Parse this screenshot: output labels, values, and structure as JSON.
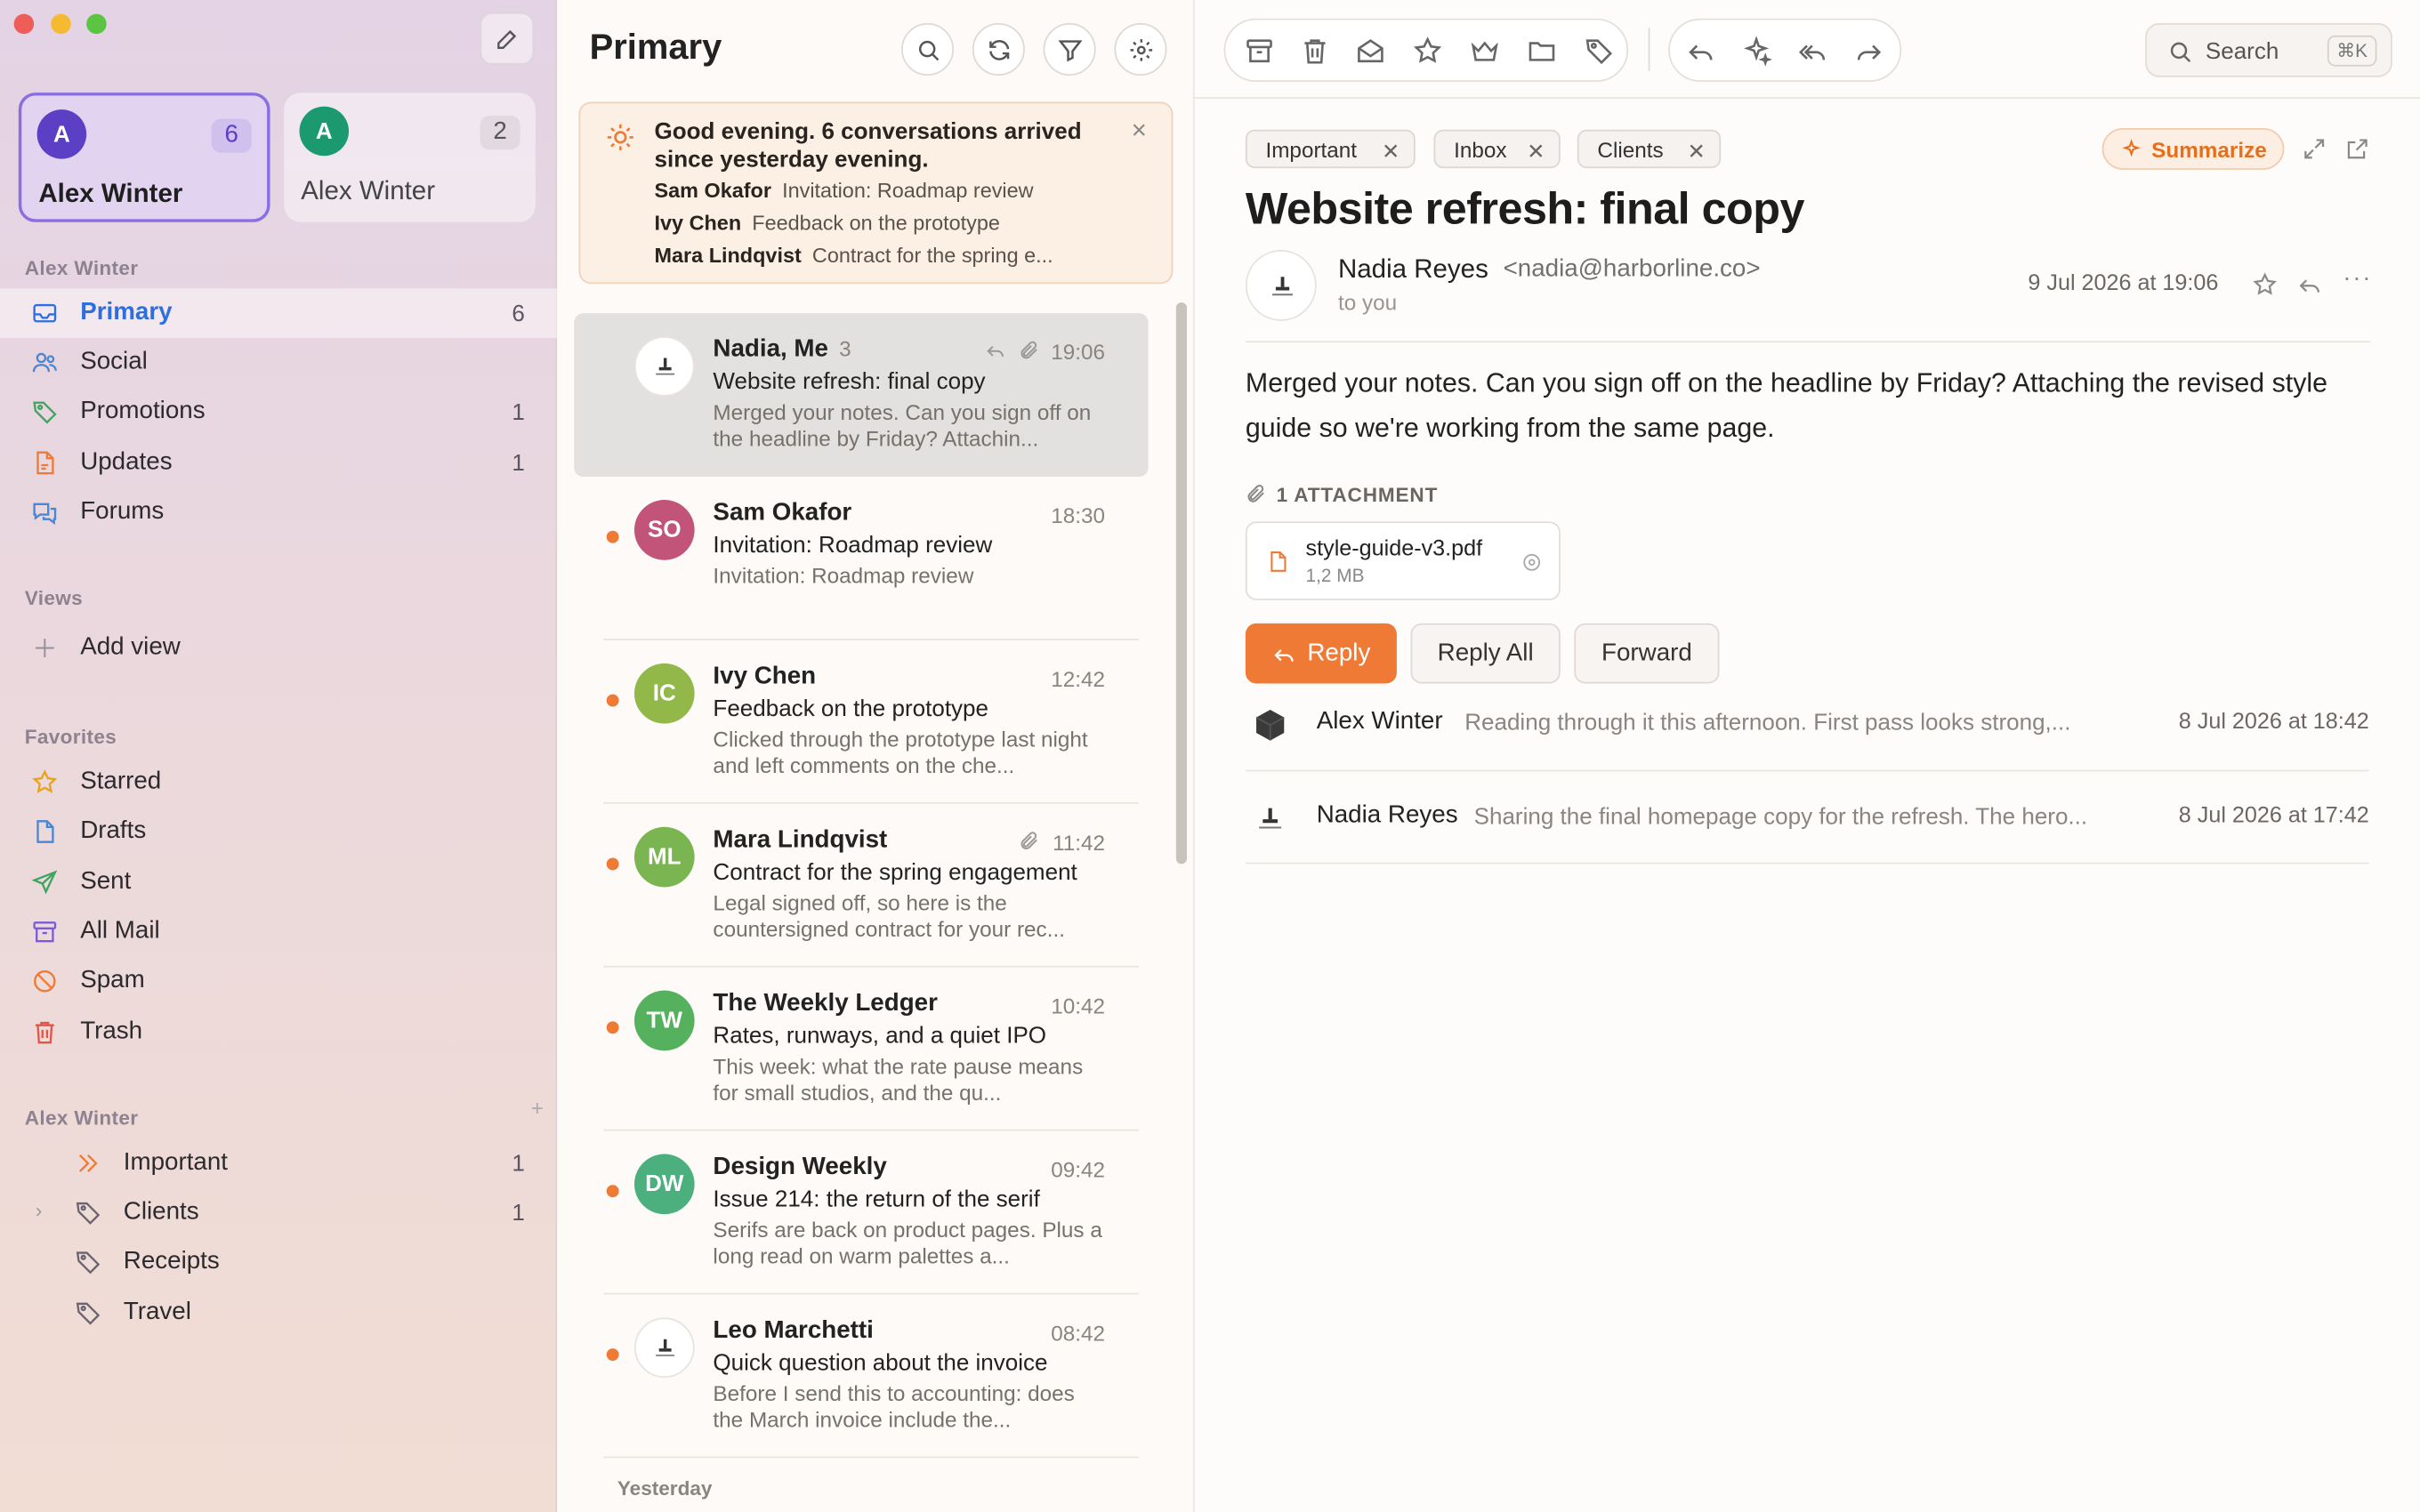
{
  "sidebar": {
    "accounts": [
      {
        "initial": "A",
        "name": "Alex Winter",
        "count": "6",
        "color": "#5b3fc4"
      },
      {
        "initial": "A",
        "name": "Alex Winter",
        "count": "2",
        "color": "#1a9a6e"
      }
    ],
    "account_section": "Alex Winter",
    "mailboxes": [
      {
        "label": "Primary",
        "count": "6",
        "icon": "inbox-icon"
      },
      {
        "label": "Social",
        "count": "",
        "icon": "people-icon"
      },
      {
        "label": "Promotions",
        "count": "1",
        "icon": "tag-icon"
      },
      {
        "label": "Updates",
        "count": "1",
        "icon": "document-icon"
      },
      {
        "label": "Forums",
        "count": "",
        "icon": "chat-bubbles-icon"
      }
    ],
    "views_section": "Views",
    "add_view": "Add view",
    "favorites_section": "Favorites",
    "favorites": [
      {
        "label": "Starred",
        "icon": "star-icon"
      },
      {
        "label": "Drafts",
        "icon": "draft-icon"
      },
      {
        "label": "Sent",
        "icon": "send-icon"
      },
      {
        "label": "All Mail",
        "icon": "archive-icon"
      },
      {
        "label": "Spam",
        "icon": "spam-icon"
      },
      {
        "label": "Trash",
        "icon": "trash-icon"
      }
    ],
    "labels_section": "Alex Winter",
    "labels": [
      {
        "label": "Important",
        "count": "1",
        "icon": "chevrons-right-icon"
      },
      {
        "label": "Clients",
        "count": "1",
        "icon": "tag-icon"
      },
      {
        "label": "Receipts",
        "count": "",
        "icon": "tag-icon"
      },
      {
        "label": "Travel",
        "count": "",
        "icon": "tag-icon"
      }
    ]
  },
  "list": {
    "title": "Primary",
    "digest": {
      "text": "Good evening. 6 conversations arrived since yesterday evening.",
      "rows": [
        {
          "name": "Sam Okafor",
          "subject": "Invitation: Roadmap review"
        },
        {
          "name": "Ivy Chen",
          "subject": "Feedback on the prototype"
        },
        {
          "name": "Mara Lindqvist",
          "subject": "Contract for the spring e..."
        }
      ]
    },
    "messages": [
      {
        "from": "Nadia, Me",
        "count": "3",
        "time": "19:06",
        "subject": "Website refresh: final copy",
        "preview": "Merged your notes. Can you sign off on the headline by Friday? Attachin...",
        "initials": "",
        "color": "#ffffff"
      },
      {
        "from": "Sam Okafor",
        "count": "",
        "time": "18:30",
        "subject": "Invitation: Roadmap review",
        "preview": "Invitation: Roadmap review",
        "initials": "SO",
        "color": "#c2547a"
      },
      {
        "from": "Ivy Chen",
        "count": "",
        "time": "12:42",
        "subject": "Feedback on the prototype",
        "preview": "Clicked through the prototype last night and left comments on the che...",
        "initials": "IC",
        "color": "#93b84a"
      },
      {
        "from": "Mara Lindqvist",
        "count": "",
        "time": "11:42",
        "subject": "Contract for the spring engagement",
        "preview": "Legal signed off, so here is the countersigned contract for your rec...",
        "initials": "ML",
        "color": "#7bb552"
      },
      {
        "from": "The Weekly Ledger",
        "count": "",
        "time": "10:42",
        "subject": "Rates, runways, and a quiet IPO",
        "preview": "This week: what the rate pause means for small studios, and the qu...",
        "initials": "TW",
        "color": "#56b15e"
      },
      {
        "from": "Design Weekly",
        "count": "",
        "time": "09:42",
        "subject": "Issue 214: the return of the serif",
        "preview": "Serifs are back on product pages. Plus a long read on warm palettes a...",
        "initials": "DW",
        "color": "#4caf7e"
      },
      {
        "from": "Leo Marchetti",
        "count": "",
        "time": "08:42",
        "subject": "Quick question about the invoice",
        "preview": "Before I send this to accounting: does the March invoice include the...",
        "initials": "",
        "color": "#ffffff"
      }
    ],
    "yesterday": "Yesterday"
  },
  "reader": {
    "search_label": "Search",
    "search_shortcut": "⌘K",
    "chips": [
      "Important",
      "Inbox",
      "Clients"
    ],
    "summarize": "Summarize",
    "subject": "Website refresh: final copy",
    "sender_name": "Nadia Reyes",
    "sender_email": "<nadia@harborline.co>",
    "to": "to you",
    "date": "9 Jul 2026 at 19:06",
    "body": "Merged your notes. Can you sign off on the headline by Friday? Attaching the revised style guide so we're working from the same page.",
    "attachment_header": "1 ATTACHMENT",
    "attachment_name": "style-guide-v3.pdf",
    "attachment_size": "1,2 MB",
    "reply": "Reply",
    "reply_all": "Reply All",
    "forward": "Forward",
    "thread": [
      {
        "name": "Alex Winter",
        "preview": "Reading through it this afternoon. First pass looks strong,...",
        "date": "8 Jul 2026 at 18:42"
      },
      {
        "name": "Nadia Reyes",
        "preview": "Sharing the final homepage copy for the refresh. The hero...",
        "date": "8 Jul 2026 at 17:42"
      }
    ]
  },
  "colors": {
    "accent": "#ee7a35",
    "selection": "#2f6fdc",
    "account_ring": "#8b6fe0"
  }
}
